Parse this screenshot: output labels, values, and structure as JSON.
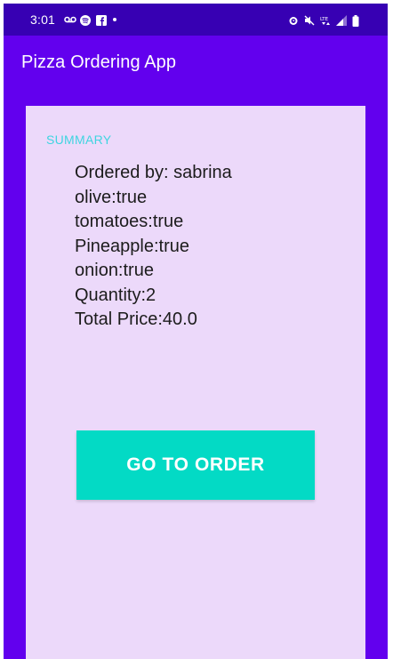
{
  "status_bar": {
    "time": "3:01",
    "left_icons": [
      "voicemail-icon",
      "spotify-icon",
      "facebook-icon",
      "dot-icon"
    ],
    "right_icons": [
      "alarm-icon",
      "mute-icon",
      "lte-icon",
      "signal-icon",
      "battery-icon"
    ]
  },
  "app_bar": {
    "title": "Pizza Ordering App"
  },
  "summary": {
    "label": "SUMMARY",
    "lines": [
      "Ordered by: sabrina",
      "olive:true",
      "tomatoes:true",
      "Pineapple:true",
      "onion:true",
      "Quantity:2",
      "Total Price:40.0"
    ]
  },
  "actions": {
    "go_to_order_label": "GO TO ORDER"
  },
  "colors": {
    "primary": "#6200ee",
    "primary_dark": "#3700b3",
    "accent": "#03dac5",
    "card_background": "#ecd9fa",
    "summary_label": "#3fd5e0"
  }
}
